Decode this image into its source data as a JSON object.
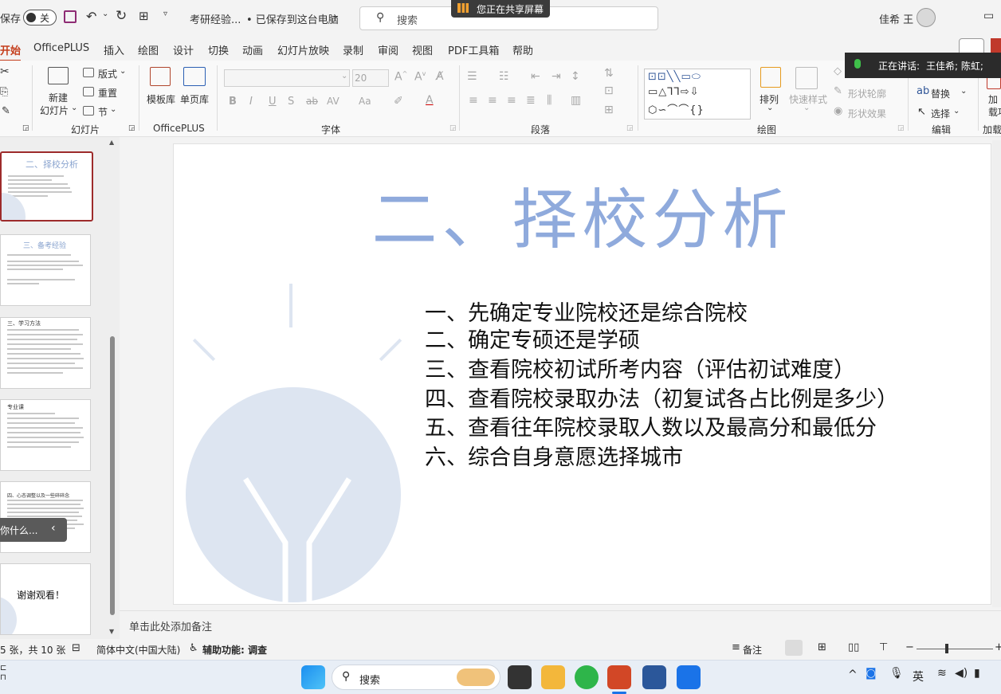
{
  "titlebar": {
    "autosave": "保存",
    "toggle": "关",
    "filename": "考研经验...",
    "saved_status": "• 已保存到这台电脑",
    "search_placeholder": "搜索",
    "sharing_banner": "您正在共享屏幕",
    "user": "佳希 王"
  },
  "tabs": [
    "开始",
    "OfficePLUS",
    "插入",
    "绘图",
    "设计",
    "切换",
    "动画",
    "幻灯片放映",
    "录制",
    "审阅",
    "视图",
    "PDF工具箱",
    "帮助"
  ],
  "ribbon": {
    "new_slide_1": "新建",
    "new_slide_2": "幻灯片",
    "layout": "版式",
    "reset": "重置",
    "section": "节",
    "group_slides": "幻灯片",
    "template_lib": "模板库",
    "single_page": "单页库",
    "group_officeplus": "OfficePLUS",
    "font_size": "20",
    "group_font": "字体",
    "group_paragraph": "段落",
    "arrange": "排列",
    "quick_styles": "快速样式",
    "shape_outline": "形状轮廓",
    "shape_effects": "形状效果",
    "group_drawing": "绘图",
    "replace": "替换",
    "select": "选择",
    "group_editing": "编辑",
    "addin_1": "加",
    "addin_2": "载项",
    "group_addin": "加载"
  },
  "speaking": {
    "label": "正在讲话:",
    "names": "王佳希; 陈虹;"
  },
  "thumbnails": [
    {
      "title": "二、择校分析"
    },
    {
      "title": "三、备考经验"
    },
    {
      "title": "三、学习方法"
    },
    {
      "title": "专业课"
    },
    {
      "title": "四、心态调整以及一些碎碎念"
    },
    {
      "title": "谢谢观看！"
    }
  ],
  "thumb_overlay": "你什么...",
  "slide": {
    "title": "二、择校分析",
    "bullets": [
      "一、先确定专业院校还是综合院校",
      "二、确定专硕还是学硕",
      "三、查看院校初试所考内容（评估初试难度）",
      "四、查看院校录取办法（初复试各占比例是多少）",
      "五、查看往年院校录取人数以及最高分和最低分",
      "六、综合自身意愿选择城市"
    ]
  },
  "notes_placeholder": "单击此处添加备注",
  "status": {
    "slide_count": "5 张，共 10 张",
    "language": "简体中文(中国大陆)",
    "accessibility": "辅助功能: 调查",
    "notes": "备注"
  },
  "taskbar": {
    "search": "搜索",
    "ime": "英"
  }
}
